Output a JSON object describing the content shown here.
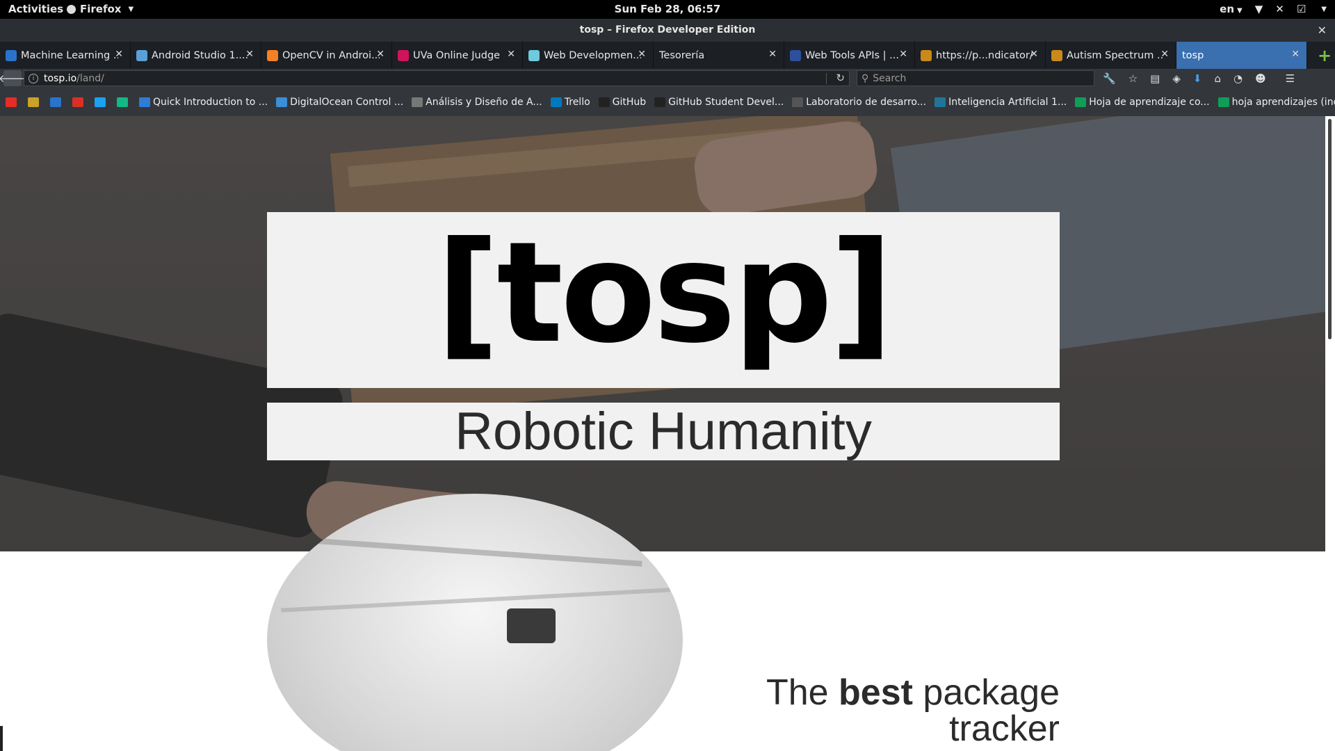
{
  "system_bar": {
    "activities": "Activities",
    "app_name": "Firefox",
    "datetime": "Sun Feb 28, 06:57",
    "language": "en"
  },
  "window": {
    "title": "tosp – Firefox Developer Edition"
  },
  "tabs": [
    {
      "label": "Machine Learning ...",
      "favicon": "coursera-icon",
      "color": "#2a73cc"
    },
    {
      "label": "Android Studio 1....",
      "favicon": "android-studio-icon",
      "color": "#5aa0d8"
    },
    {
      "label": "OpenCV in Androi...",
      "favicon": "stackoverflow-icon",
      "color": "#f48024"
    },
    {
      "label": "UVa Online Judge",
      "favicon": "uva-icon",
      "color": "#d0145c"
    },
    {
      "label": "Web Developmen...",
      "favicon": "slack-icon",
      "color": "#6ecadc"
    },
    {
      "label": "Tesorería",
      "favicon": "",
      "color": ""
    },
    {
      "label": "Web Tools APIs | ...",
      "favicon": "usps-icon",
      "color": "#2d4f9e"
    },
    {
      "label": "https://p...ndicator/",
      "favicon": "page-icon",
      "color": "#c98a1b"
    },
    {
      "label": "Autism Spectrum ...",
      "favicon": "page-icon",
      "color": "#c98a1b"
    },
    {
      "label": "tosp",
      "favicon": "",
      "color": "",
      "active": true
    }
  ],
  "navbar": {
    "url_host": "tosp.io",
    "url_path": "/land/",
    "search_placeholder": "Search"
  },
  "bookmarks": [
    {
      "label": "",
      "icon": "youtube-icon",
      "color": "#e52d27"
    },
    {
      "label": "",
      "icon": "shield-icon",
      "color": "#c9a227"
    },
    {
      "label": "",
      "icon": "coursera-icon",
      "color": "#2a73cc"
    },
    {
      "label": "",
      "icon": "gmail-icon",
      "color": "#d93025"
    },
    {
      "label": "",
      "icon": "twitter-icon",
      "color": "#1da1f2"
    },
    {
      "label": "",
      "icon": "medium-icon",
      "color": "#12b886"
    },
    {
      "label": "Quick Introduction to ...",
      "icon": "m-icon",
      "color": "#2f7bd8"
    },
    {
      "label": "DigitalOcean Control ...",
      "icon": "cloud-icon",
      "color": "#3a8fd6"
    },
    {
      "label": "Análisis y Diseño de A...",
      "icon": "globe-icon",
      "color": "#777777"
    },
    {
      "label": "Trello",
      "icon": "trello-icon",
      "color": "#0079bf"
    },
    {
      "label": "GitHub",
      "icon": "github-icon",
      "color": "#222222"
    },
    {
      "label": "GitHub Student Devel...",
      "icon": "github-icon",
      "color": "#222222"
    },
    {
      "label": "Laboratorio de desarro...",
      "icon": "lab-icon",
      "color": "#555555"
    },
    {
      "label": "Inteligencia Artificial 1...",
      "icon": "wordpress-icon",
      "color": "#21759b"
    },
    {
      "label": "Hoja de aprendizaje co...",
      "icon": "sheets-icon",
      "color": "#0f9d58"
    },
    {
      "label": "hoja aprendizajes (indi...",
      "icon": "sheets-icon",
      "color": "#0f9d58"
    }
  ],
  "page": {
    "logo": "[tosp]",
    "tagline": "Robotic Humanity",
    "feature": {
      "prefix": "The ",
      "bold": "best",
      "suffix": " package tracker"
    }
  }
}
